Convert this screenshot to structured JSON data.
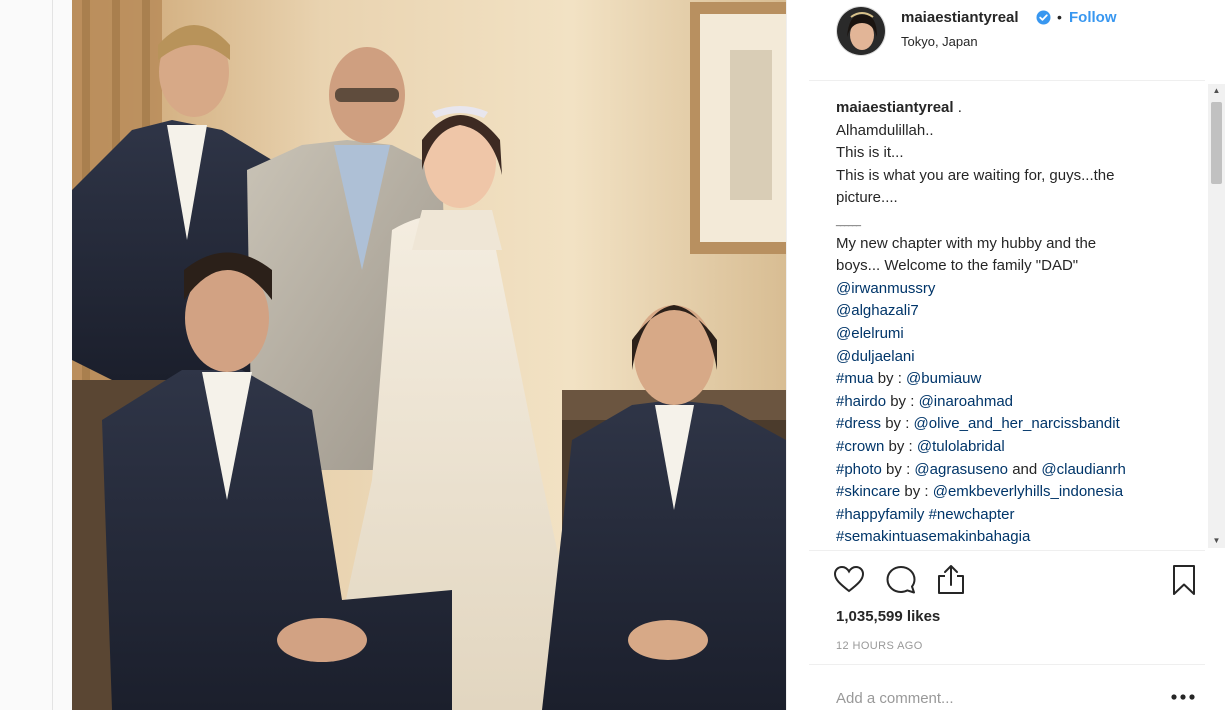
{
  "post": {
    "username": "maiaestiantyreal",
    "location": "Tokyo, Japan",
    "follow_label": "Follow",
    "separator": "•",
    "likes": "1,035,599 likes",
    "timestamp": "12 HOURS AGO",
    "comment_placeholder": "Add a comment..."
  },
  "caption": {
    "author": "maiaestiantyreal",
    "author_suffix": " .",
    "lines": [
      "Alhamdulillah..",
      "This is it...",
      "This is what you are waiting for, guys...the",
      "picture....",
      "______",
      "My new chapter with my hubby and the",
      "boys... Welcome to the family \"DAD\""
    ],
    "mentions": [
      "@irwanmussry",
      "@alghazali7",
      "@elelrumi",
      "@duljaelani"
    ],
    "credits": [
      {
        "tag": "#mua",
        "text": " by : ",
        "handle": "@bumiauw"
      },
      {
        "tag": "#hairdo",
        "text": " by : ",
        "handle": "@inaroahmad"
      },
      {
        "tag": "#dress",
        "text": " by : ",
        "handle": "@olive_and_her_narcissbandit"
      },
      {
        "tag": "#crown",
        "text": " by : ",
        "handle": "@tulolabridal"
      },
      {
        "tag": "#photo",
        "text": " by : ",
        "handle": "@agrasuseno",
        "and": " and ",
        "handle2": "@claudianrh"
      },
      {
        "tag": "#skincare",
        "text": " by : ",
        "handle": "@emkbeverlyhills_indonesia"
      }
    ],
    "hashtags_line": [
      "#happyfamily",
      "#newchapter"
    ],
    "last_hashtag": "#semakintuasemakinbahagia"
  },
  "icons": {
    "verified": "verified-badge-icon",
    "like": "heart-icon",
    "comment": "comment-bubble-icon",
    "share": "share-icon",
    "save": "bookmark-icon",
    "more": "more-options-icon"
  },
  "colors": {
    "link": "#003569",
    "follow": "#3897f0",
    "verified": "#3897f0",
    "muted": "#999999"
  }
}
